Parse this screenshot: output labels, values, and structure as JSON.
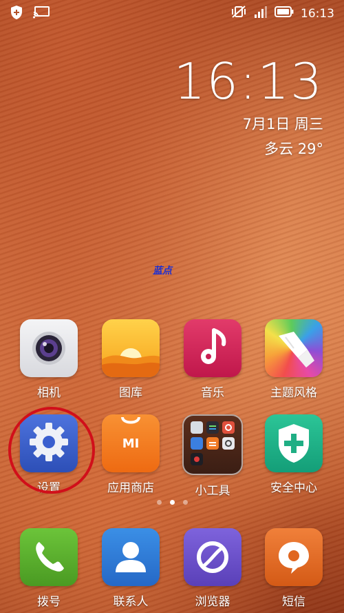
{
  "status_bar": {
    "left_icons": [
      "shield-plus-icon",
      "screen-cast-icon"
    ],
    "right_icons": [
      "vibrate-off-icon",
      "signal-icon",
      "battery-icon"
    ],
    "time": "16:13"
  },
  "clock": {
    "time": "16:13",
    "date": "7月1日 周三",
    "weather": "多云  29°"
  },
  "watermark": "蓝点",
  "apps": [
    {
      "label": "相机",
      "icon": "camera-icon"
    },
    {
      "label": "图库",
      "icon": "gallery-icon"
    },
    {
      "label": "音乐",
      "icon": "music-icon"
    },
    {
      "label": "主题风格",
      "icon": "theme-brush-icon"
    },
    {
      "label": "设置",
      "icon": "gear-icon"
    },
    {
      "label": "应用商店",
      "icon": "mi-store-icon"
    },
    {
      "label": "小工具",
      "icon": "tools-folder-icon"
    },
    {
      "label": "安全中心",
      "icon": "security-shield-icon"
    }
  ],
  "page_indicator": {
    "pages": 3,
    "current": 2
  },
  "dock": [
    {
      "label": "拨号",
      "icon": "phone-icon"
    },
    {
      "label": "联系人",
      "icon": "contacts-icon"
    },
    {
      "label": "浏览器",
      "icon": "browser-icon"
    },
    {
      "label": "短信",
      "icon": "sms-icon"
    }
  ],
  "colors": {
    "highlight_circle": "#d10f1a",
    "settings_icon_bg": "#3a5fcf",
    "store_icon_bg": "#f47a1f",
    "security_icon_bg": "#22b58a",
    "phone_icon_bg": "#5aa82b",
    "contacts_icon_bg": "#2f7fd6",
    "browser_icon_bg": "#6a52c9",
    "sms_icon_bg": "#e86a1e"
  }
}
